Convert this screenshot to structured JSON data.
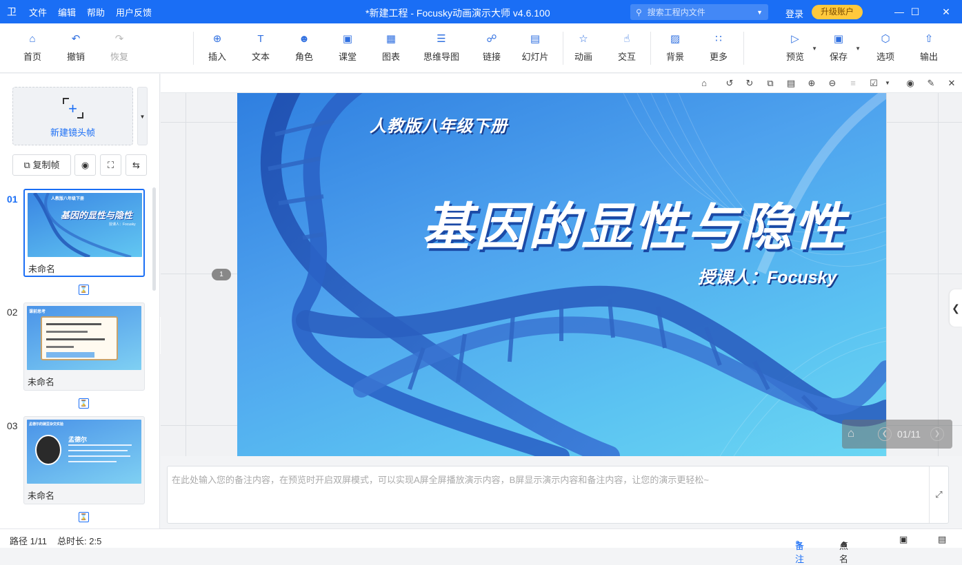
{
  "titlebar": {
    "logo": "卫",
    "menu": [
      "文件",
      "编辑",
      "帮助",
      "用户反馈"
    ],
    "title": "*新建工程 - Focusky动画演示大师  v4.6.100",
    "search_placeholder": "搜索工程内文件",
    "login": "登录",
    "upgrade": "升级账户",
    "brand_color": "#1a6ef5",
    "upgrade_color": "#ffc93c"
  },
  "toolbar": {
    "home": "首页",
    "undo": "撤销",
    "redo": "恢复",
    "insert": "插入",
    "text": "文本",
    "role": "角色",
    "classroom": "课堂",
    "chart": "图表",
    "mindmap": "思维导图",
    "link": "链接",
    "slides": "幻灯片",
    "animation": "动画",
    "interact": "交互",
    "background": "背景",
    "more": "更多",
    "preview": "预览",
    "save": "保存",
    "options": "选项",
    "export": "输出"
  },
  "left": {
    "new_frame": "新建镜头帧",
    "copy_frame": "复制帧",
    "frames": [
      {
        "num": "01",
        "name": "未命名",
        "thumb_title": "基因的显性与隐性",
        "thumb_sub": "人教版八年级下册",
        "thumb_author": "授课人：Focusky"
      },
      {
        "num": "02",
        "name": "未命名",
        "thumb_tag": "课前思考"
      },
      {
        "num": "03",
        "name": "未命名",
        "thumb_tag": "孟德尔的豌豆杂交实验",
        "thumb_person": "孟德尔"
      }
    ]
  },
  "canvas": {
    "frame_marker": "1",
    "slide": {
      "subtitle": "人教版八年级下册",
      "title": "基因的显性与隐性",
      "author": "授课人：Focusky"
    },
    "page_indicator": "01/11"
  },
  "notes": {
    "placeholder": "在此处输入您的备注内容，在预览时开启双屏模式，可以实现A屏全屏播放演示内容，B屏显示演示内容和备注内容，让您的演示更轻松~"
  },
  "status": {
    "path": "路径 1/11",
    "duration": "总时长: 2:5",
    "notes": "备注",
    "rollcall": "点名"
  }
}
